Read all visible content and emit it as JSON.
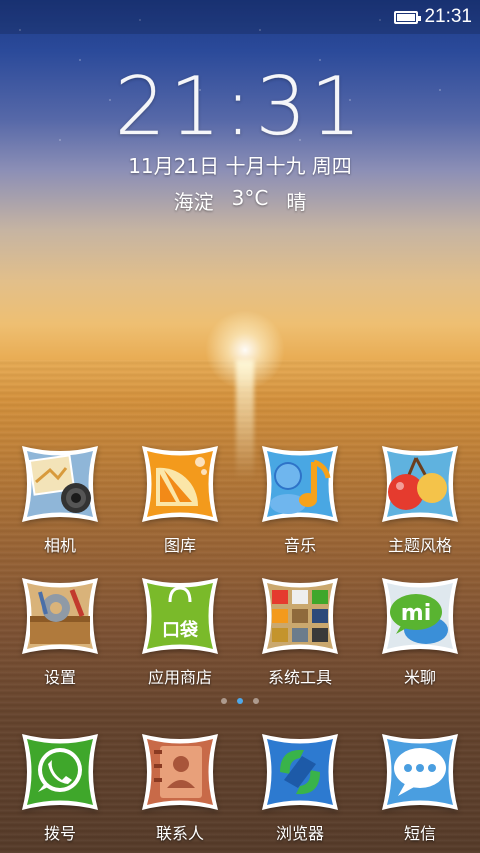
{
  "status_bar": {
    "time": "21:31",
    "battery_icon": "battery-icon",
    "battery_level": 1.0
  },
  "lock_widget": {
    "time": "21:31",
    "date": "11月21日 十月十九 周四",
    "weather": {
      "location": "海淀",
      "temperature": "3°C",
      "condition": "晴"
    }
  },
  "apps": [
    {
      "label": "相机",
      "icon": "camera-icon",
      "color": "#6b8cc2"
    },
    {
      "label": "图库",
      "icon": "gallery-icon",
      "color": "#f39a1c"
    },
    {
      "label": "音乐",
      "icon": "music-icon",
      "color": "#49a7e3"
    },
    {
      "label": "主题风格",
      "icon": "theme-icon",
      "color": "#e53b2e"
    },
    {
      "label": "设置",
      "icon": "settings-icon",
      "color": "#b07a3c"
    },
    {
      "label": "应用商店",
      "icon": "app-store-icon",
      "color": "#7aba2a"
    },
    {
      "label": "系统工具",
      "icon": "system-tools-folder-icon",
      "color": "#c1a97a"
    },
    {
      "label": "米聊",
      "icon": "miliao-icon",
      "color": "#59b431"
    }
  ],
  "app_store_badge": "口袋",
  "miliao_badge": "mi",
  "pager": {
    "count": 3,
    "active_index": 1
  },
  "dock": [
    {
      "label": "拨号",
      "icon": "phone-icon",
      "color": "#3fa72b"
    },
    {
      "label": "联系人",
      "icon": "contacts-icon",
      "color": "#a8553a"
    },
    {
      "label": "浏览器",
      "icon": "browser-icon",
      "color": "#2d7ad0"
    },
    {
      "label": "短信",
      "icon": "messages-icon",
      "color": "#3a8fd8"
    }
  ]
}
